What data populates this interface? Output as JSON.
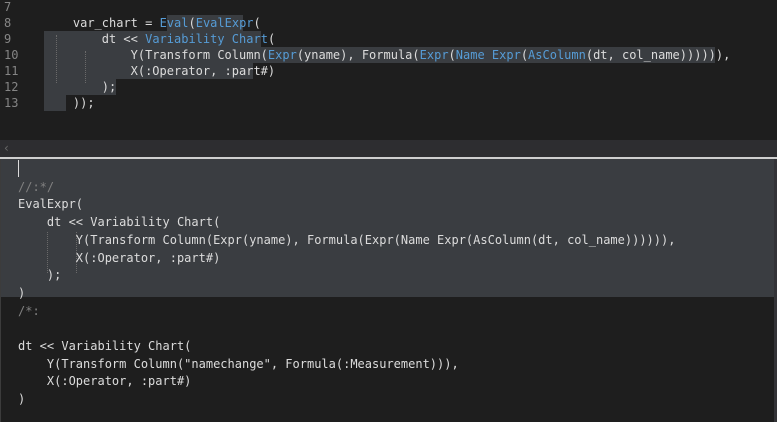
{
  "top_editor": {
    "line_numbers": [
      "7",
      "8",
      "9",
      "10",
      "11",
      "12",
      "13"
    ],
    "lines": [
      {
        "segments": []
      },
      {
        "segments": [
          {
            "t": "var_chart = ",
            "c": "plain"
          },
          {
            "t": "Eval",
            "c": "kw"
          },
          {
            "t": "(",
            "c": "plain"
          },
          {
            "t": "EvalExpr",
            "c": "kw"
          },
          {
            "t": "(",
            "c": "plain"
          }
        ]
      },
      {
        "segments": [
          {
            "t": "dt << ",
            "c": "plain"
          },
          {
            "t": "Variability Chart",
            "c": "kw"
          },
          {
            "t": "(",
            "c": "plain"
          }
        ]
      },
      {
        "segments": [
          {
            "t": "Y(Transform Column(",
            "c": "plain"
          },
          {
            "t": "Expr",
            "c": "kw"
          },
          {
            "t": "(yname), Formula(",
            "c": "plain"
          },
          {
            "t": "Expr",
            "c": "kw"
          },
          {
            "t": "(",
            "c": "plain"
          },
          {
            "t": "Name Expr",
            "c": "kw"
          },
          {
            "t": "(",
            "c": "plain"
          },
          {
            "t": "AsColumn",
            "c": "kw"
          },
          {
            "t": "(dt, col_name)))))),",
            "c": "plain"
          }
        ]
      },
      {
        "segments": [
          {
            "t": "X(:Operator, :part#)",
            "c": "plain"
          }
        ]
      },
      {
        "segments": [
          {
            "t": ");",
            "c": "plain"
          }
        ]
      },
      {
        "segments": [
          {
            "t": "));",
            "c": "plain"
          }
        ]
      }
    ]
  },
  "scroll_arrow": "‹",
  "bottom_editor": {
    "lines": [
      "",
      "//:*/",
      "EvalExpr(",
      "    dt << Variability Chart(",
      "        Y(Transform Column(Expr(yname), Formula(Expr(Name Expr(AsColumn(dt, col_name)))))),",
      "        X(:Operator, :part#)",
      "    );",
      ")",
      "/*:",
      "",
      "dt << Variability Chart(",
      "    Y(Transform Column(\"namechange\", Formula(:Measurement))),",
      "    X(:Operator, :part#)",
      ")"
    ]
  },
  "colors": {
    "background": "#1e1e1e",
    "selection": "#3a3d41",
    "keyword": "#569cd6",
    "comment": "#808080",
    "line_number": "#858585"
  }
}
